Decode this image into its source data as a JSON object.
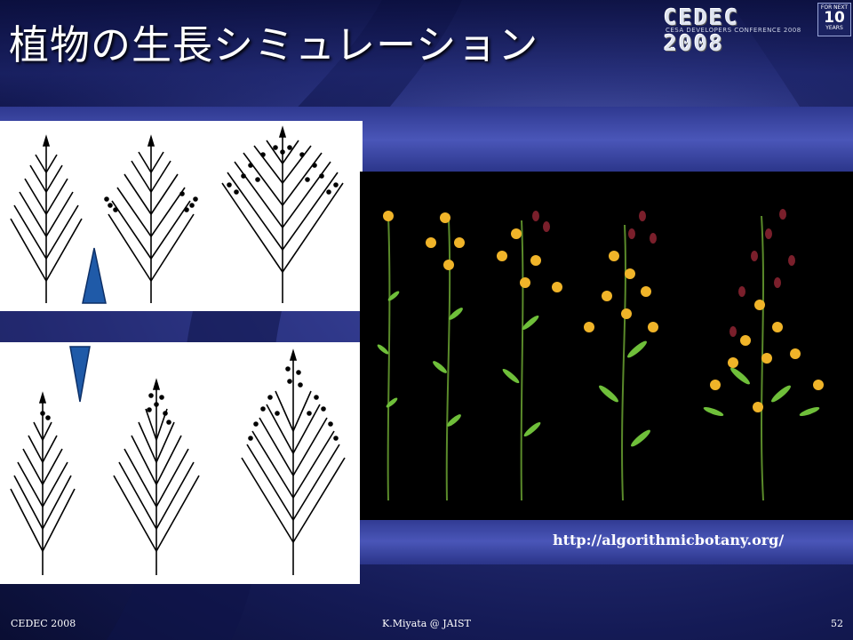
{
  "slide": {
    "title": "植物の生長シミュレーション",
    "url": "http://algorithmicbotany.org/"
  },
  "logo": {
    "name": "CEDEC 2008",
    "subtitle": "CESA DEVELOPERS CONFERENCE 2008",
    "badge_top": "FOR NEXT",
    "badge_number": "10",
    "badge_bottom": "YEARS"
  },
  "footer": {
    "left": "CEDEC 2008",
    "center": "K.Miyata @ JAIST",
    "page_number": "52"
  },
  "colors": {
    "background": "#1e2670",
    "arrow": "#1f5aa8",
    "flower_yellow": "#f0b429",
    "flower_red": "#7a1f2b"
  },
  "icons": {
    "up_arrow": "triangle-up",
    "down_arrow": "triangle-down"
  }
}
